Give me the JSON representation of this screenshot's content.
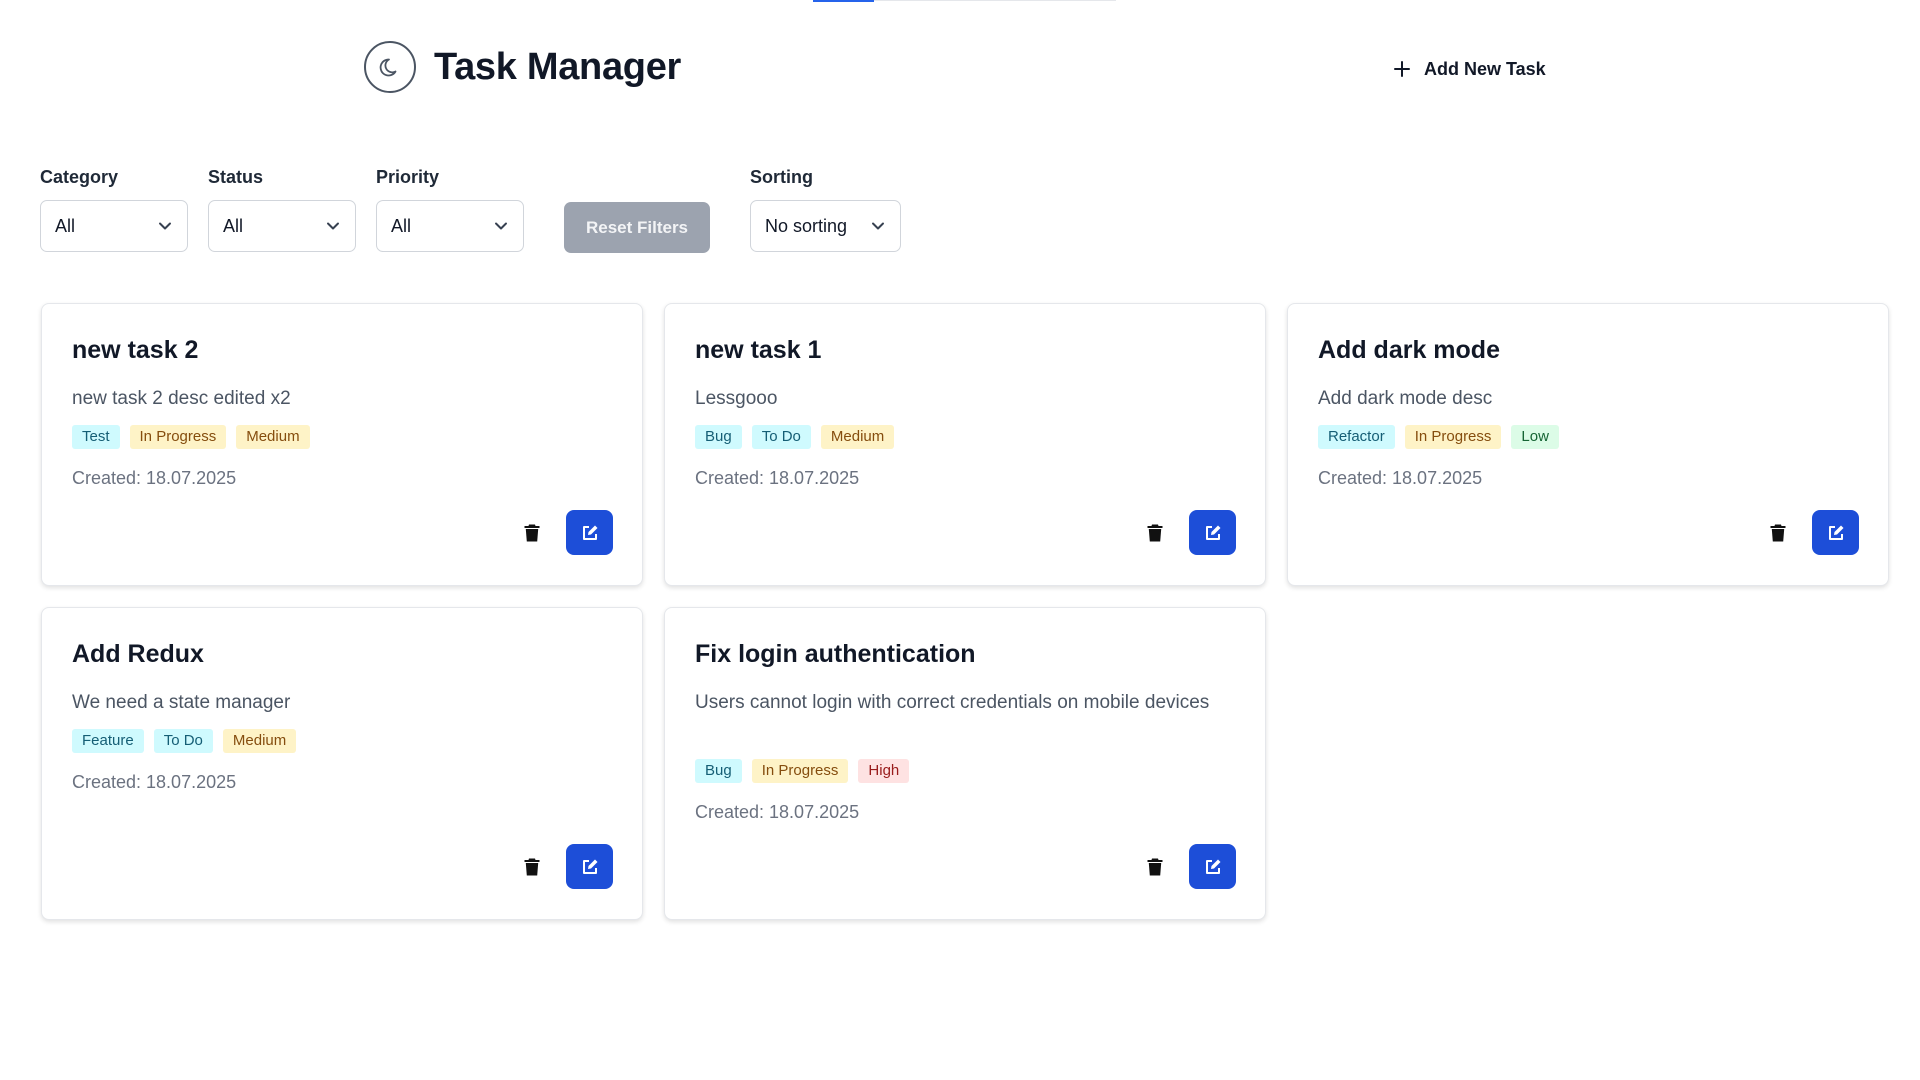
{
  "app": {
    "title": "Task Manager",
    "add_task_label": "Add New Task"
  },
  "filters": {
    "category": {
      "label": "Category",
      "value": "All"
    },
    "status": {
      "label": "Status",
      "value": "All"
    },
    "priority": {
      "label": "Priority",
      "value": "All"
    },
    "reset_label": "Reset Filters",
    "sorting": {
      "label": "Sorting",
      "value": "No sorting"
    }
  },
  "tasks": [
    {
      "title": "new task 2",
      "description": "new task 2 desc edited x2",
      "category": "Test",
      "status": "In Progress",
      "priority": "Medium",
      "created": "Created: 18.07.2025"
    },
    {
      "title": "new task 1",
      "description": "Lessgooo",
      "category": "Bug",
      "status": "To Do",
      "priority": "Medium",
      "created": "Created: 18.07.2025"
    },
    {
      "title": "Add dark mode",
      "description": "Add dark mode desc",
      "category": "Refactor",
      "status": "In Progress",
      "priority": "Low",
      "created": "Created: 18.07.2025"
    },
    {
      "title": "Add Redux",
      "description": "We need a state manager",
      "category": "Feature",
      "status": "To Do",
      "priority": "Medium",
      "created": "Created: 18.07.2025"
    },
    {
      "title": "Fix login authentication",
      "description": "Users cannot login with correct credentials on mobile devices",
      "category": "Bug",
      "status": "In Progress",
      "priority": "High",
      "created": "Created: 18.07.2025"
    }
  ],
  "colors": {
    "primary": "#1d4ed8",
    "reset_disabled": "#9ca3af",
    "progress": "#2563eb"
  },
  "icons": {
    "theme": "moon-icon",
    "add": "plus-icon",
    "delete": "trash-icon",
    "edit": "edit-icon",
    "dropdown": "chevron-down-icon"
  }
}
